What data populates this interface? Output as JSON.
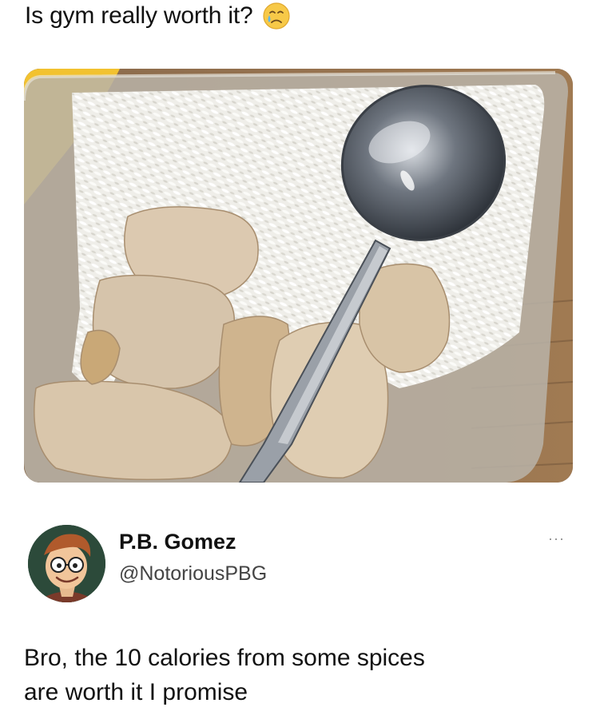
{
  "caption": {
    "text": "Is gym really worth it?",
    "emoji": "crying-face-emoji"
  },
  "photo": {
    "description_icon": "meal-prep-container-photo"
  },
  "tweet": {
    "display_name": "P.B. Gomez",
    "handle": "@NotoriousPBG",
    "more_label": "···",
    "body_lines": [
      "Bro, the 10 calories from some spices",
      "are worth it I promise"
    ]
  },
  "colors": {
    "text": "#111111",
    "handle": "#444444",
    "muted": "#8a8a8a",
    "background": "#ffffff"
  }
}
